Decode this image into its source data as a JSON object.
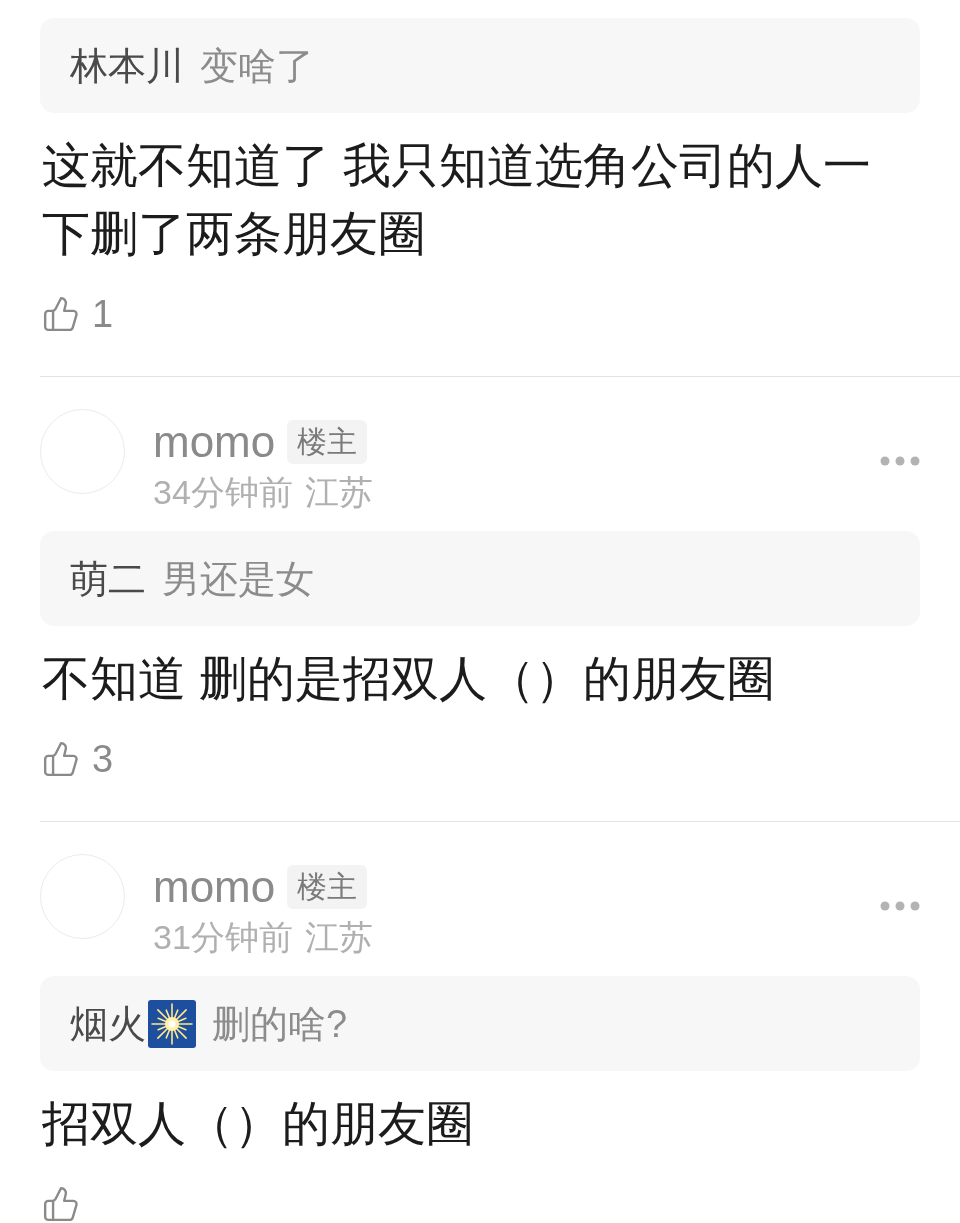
{
  "comments": [
    {
      "quote": {
        "author": "林本川",
        "name_emoji": false,
        "text": "变啥了"
      },
      "text": "这就不知道了 我只知道选角公司的人一下删了两条朋友圈",
      "likes": "1"
    },
    {
      "author": {
        "name": "momo",
        "badge": "楼主",
        "time": "34分钟前",
        "location": "江苏"
      },
      "quote": {
        "author": "萌二",
        "name_emoji": false,
        "text": "男还是女"
      },
      "text": "不知道 删的是招双人（）的朋友圈",
      "likes": "3"
    },
    {
      "author": {
        "name": "momo",
        "badge": "楼主",
        "time": "31分钟前",
        "location": "江苏"
      },
      "quote": {
        "author": "烟火",
        "name_emoji": true,
        "text": "删的啥?"
      },
      "text": "招双人（）的朋友圈"
    }
  ]
}
